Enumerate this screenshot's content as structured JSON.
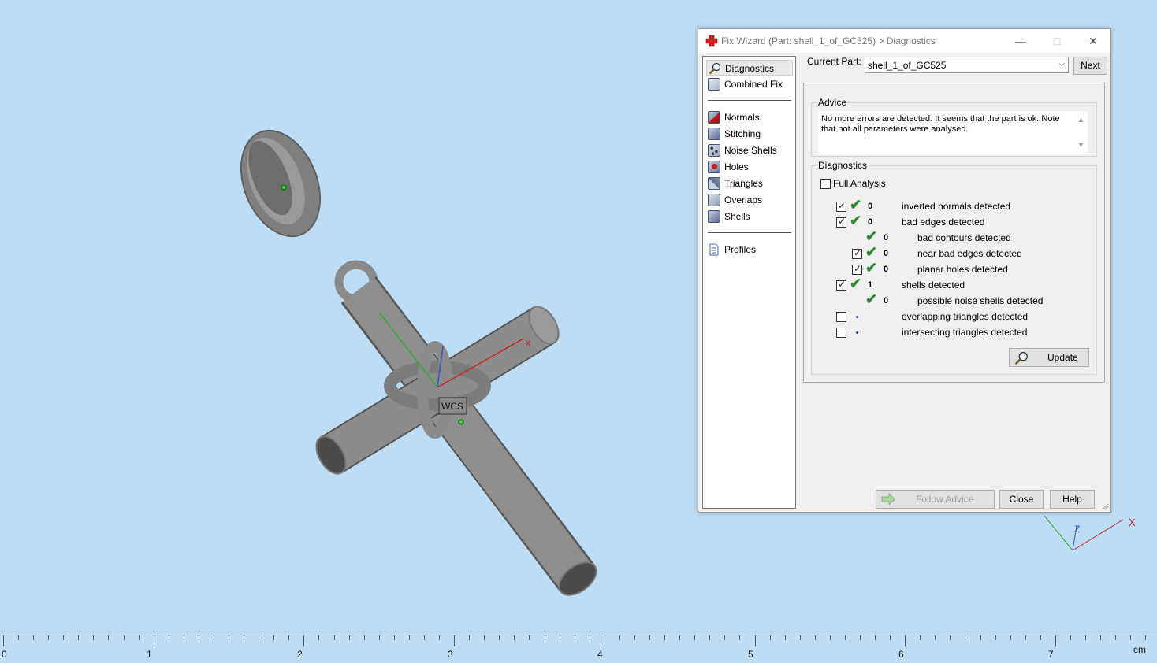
{
  "viewport": {
    "background": "#bddcf5",
    "wcs_label": "WCS",
    "axis_x_label": "x",
    "mini_axes": {
      "x_label": "X",
      "z_label": "Z"
    }
  },
  "ruler": {
    "labels": [
      "0",
      "1",
      "2",
      "3",
      "4",
      "5",
      "6",
      "7"
    ],
    "unit": "cm"
  },
  "dialog": {
    "title": "Fix Wizard (Part: shell_1_of_GC525) > Diagnostics",
    "title_icon": "red-cross-icon",
    "controls": {
      "minimize": "—",
      "maximize": "□",
      "close": "✕"
    },
    "nav": {
      "group1": [
        {
          "label": "Diagnostics",
          "icon": "magnifier-icon",
          "selected": true
        },
        {
          "label": "Combined Fix",
          "icon": "cube-icon"
        }
      ],
      "group2": [
        {
          "label": "Normals",
          "icon": "normals-cube-icon"
        },
        {
          "label": "Stitching",
          "icon": "stitching-cube-icon"
        },
        {
          "label": "Noise Shells",
          "icon": "noise-shells-icon"
        },
        {
          "label": "Holes",
          "icon": "holes-cube-icon"
        },
        {
          "label": "Triangles",
          "icon": "triangles-cube-icon"
        },
        {
          "label": "Overlaps",
          "icon": "overlaps-cube-icon"
        },
        {
          "label": "Shells",
          "icon": "shells-cube-icon"
        }
      ],
      "group3": [
        {
          "label": "Profiles",
          "icon": "document-icon"
        }
      ]
    },
    "current_part_label": "Current Part:",
    "current_part_value": "shell_1_of_GC525",
    "next_label": "Next",
    "advice": {
      "title": "Advice",
      "text": "No more errors are detected. It seems that the part is ok. Note that not all parameters were analysed."
    },
    "diagnostics": {
      "title": "Diagnostics",
      "full_analysis_label": "Full Analysis",
      "full_analysis_checked": false,
      "rows": [
        {
          "checkbox": true,
          "checked": true,
          "status": "ok",
          "count": "0",
          "label": "inverted normals detected",
          "indent": 0
        },
        {
          "checkbox": true,
          "checked": true,
          "status": "ok",
          "count": "0",
          "label": "bad edges detected",
          "indent": 0
        },
        {
          "checkbox": false,
          "checked": false,
          "status": "ok",
          "count": "0",
          "label": "bad contours detected",
          "indent": 1
        },
        {
          "checkbox": true,
          "checked": true,
          "status": "ok",
          "count": "0",
          "label": "near bad edges detected",
          "indent": 1
        },
        {
          "checkbox": true,
          "checked": true,
          "status": "ok",
          "count": "0",
          "label": "planar holes detected",
          "indent": 1
        },
        {
          "checkbox": true,
          "checked": true,
          "status": "ok",
          "count": "1",
          "label": "shells detected",
          "indent": 0
        },
        {
          "checkbox": false,
          "checked": false,
          "status": "ok",
          "count": "0",
          "label": "possible noise shells detected",
          "indent": 1
        },
        {
          "checkbox": true,
          "checked": false,
          "status": "pending",
          "count": "",
          "label": "overlapping triangles detected",
          "indent": 0
        },
        {
          "checkbox": true,
          "checked": false,
          "status": "pending",
          "count": "",
          "label": "intersecting triangles detected",
          "indent": 0
        }
      ],
      "update_label": "Update"
    },
    "footer": {
      "follow_advice_label": "Follow Advice",
      "follow_advice_enabled": false,
      "close_label": "Close",
      "help_label": "Help"
    }
  }
}
